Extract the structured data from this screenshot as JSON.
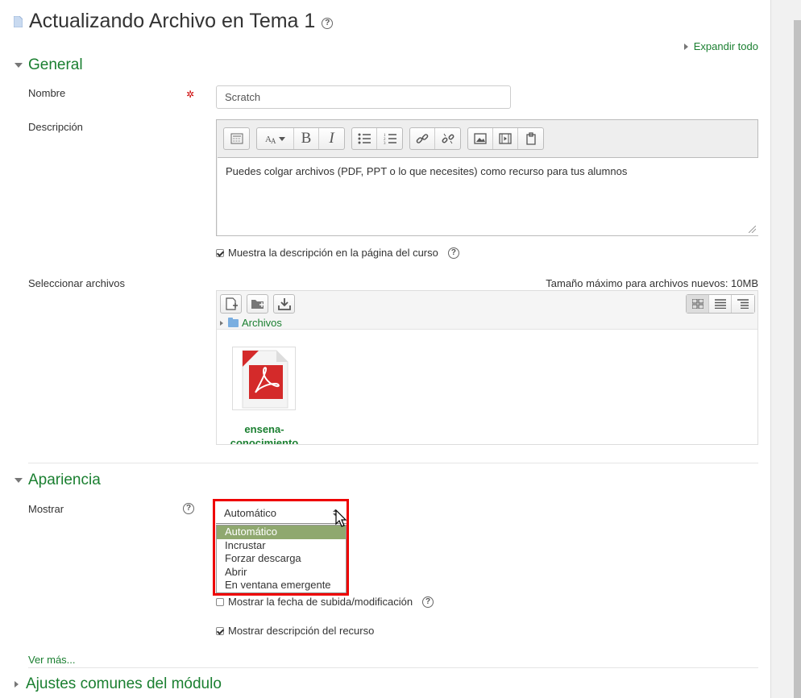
{
  "page": {
    "title": "Actualizando Archivo en Tema 1",
    "expand_all": "Expandir todo"
  },
  "general": {
    "section_label": "General",
    "name_label": "Nombre",
    "name_value": "Scratch",
    "description_label": "Descripción",
    "description_text": "Puedes colgar archivos (PDF, PPT o lo que necesites) como recurso para tus alumnos",
    "show_description_label": "Muestra la descripción en la página del curso",
    "show_description_checked": true,
    "select_files_label": "Seleccionar archivos",
    "max_size": "Tamaño máximo para archivos nuevos: 10MB",
    "files_path": "Archivos",
    "file_name": "ensena-conocimiento",
    "editor_toolbar": [
      "toolbar-toggle",
      "font-style",
      "bold",
      "italic",
      "bullet-list",
      "numbered-list",
      "link",
      "unlink",
      "image",
      "media",
      "manage-files"
    ]
  },
  "appearance": {
    "section_label": "Apariencia",
    "display_label": "Mostrar",
    "display_selected": "Automático",
    "display_options": [
      "Automático",
      "Incrustar",
      "Forzar descarga",
      "Abrir",
      "En ventana emergente"
    ],
    "show_date_label": "Mostrar la fecha de subida/modificación",
    "show_date_checked": false,
    "show_resource_desc_label": "Mostrar descripción del recurso",
    "show_resource_desc_checked": true,
    "see_more": "Ver más..."
  },
  "module_settings": {
    "section_label": "Ajustes comunes del módulo"
  },
  "colors": {
    "link_green": "#1a7f30",
    "selected_option": "#8fa86f",
    "highlight_box": "#ee0000"
  }
}
